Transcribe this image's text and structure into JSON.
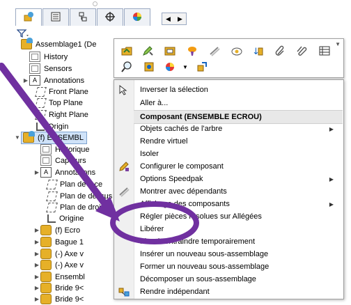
{
  "tree": {
    "tab_icons": [
      "featuremanager-icon",
      "propertymanager-icon",
      "configuration-icon",
      "dimxpert-icon",
      "appearance-icon"
    ],
    "filter_icon": "filter-icon",
    "items": [
      {
        "label": "Assemblage1 (De",
        "icon": "assembly-icon",
        "expander": ""
      },
      {
        "label": "History",
        "icon": "history-icon",
        "expander": ""
      },
      {
        "label": "Sensors",
        "icon": "sensors-icon",
        "expander": ""
      },
      {
        "label": "Annotations",
        "icon": "annotations-icon",
        "expander": "▶"
      },
      {
        "label": "Front Plane",
        "icon": "plane-icon",
        "expander": ""
      },
      {
        "label": "Top Plane",
        "icon": "plane-icon",
        "expander": ""
      },
      {
        "label": "Right Plane",
        "icon": "plane-icon",
        "expander": ""
      },
      {
        "label": "Origin",
        "icon": "origin-icon",
        "expander": ""
      },
      {
        "label": "(f) ENSEMBL",
        "icon": "assembly-icon",
        "expander": "▼"
      },
      {
        "label": "Historique",
        "icon": "history-icon",
        "expander": ""
      },
      {
        "label": "Capteurs",
        "icon": "sensors-icon",
        "expander": ""
      },
      {
        "label": "Annotations",
        "icon": "annotations-icon",
        "expander": "▶"
      },
      {
        "label": "Plan de face",
        "icon": "plane-icon",
        "expander": ""
      },
      {
        "label": "Plan de dessus",
        "icon": "plane-icon",
        "expander": ""
      },
      {
        "label": "Plan de droite",
        "icon": "plane-icon",
        "expander": ""
      },
      {
        "label": "Origine",
        "icon": "origin-icon",
        "expander": ""
      },
      {
        "label": "(f) Ecro",
        "icon": "part-icon",
        "expander": "▶"
      },
      {
        "label": "Bague 1",
        "icon": "part-icon",
        "expander": "▶"
      },
      {
        "label": "(-) Axe v",
        "icon": "part-icon",
        "expander": "▶"
      },
      {
        "label": "(-) Axe v",
        "icon": "part-icon",
        "expander": "▶"
      },
      {
        "label": "Ensembl",
        "icon": "part-icon",
        "expander": "▶"
      },
      {
        "label": "Bride 9<",
        "icon": "part-icon",
        "expander": "▶"
      },
      {
        "label": "Bride 9<",
        "icon": "part-icon",
        "expander": "▶"
      }
    ]
  },
  "toolbar": {
    "row1": [
      "open-part-icon",
      "edit-component-icon",
      "component-properties-icon",
      "appearance-brush-icon",
      "hide-icon",
      "isolate-icon",
      "mate-icon",
      "paperclip-icon",
      "link-icon",
      "table-icon"
    ],
    "row2": [
      "zoom-to-selection-icon",
      "component-view-icon",
      "appearance-ball-icon",
      "dropdown-arrow-icon",
      "configure-icon"
    ]
  },
  "menu": {
    "items": [
      {
        "label": "Inverser la sélection",
        "type": "item",
        "icon": "invert-selection-icon",
        "submenu": false
      },
      {
        "label": "Aller à...",
        "type": "item",
        "icon": "",
        "submenu": false
      },
      {
        "label": "Composant (ENSEMBLE ECROU)",
        "type": "header"
      },
      {
        "label": "Objets cachés de l'arbre",
        "type": "item",
        "icon": "",
        "submenu": true
      },
      {
        "label": "Rendre virtuel",
        "type": "item",
        "icon": "",
        "submenu": false
      },
      {
        "label": "Isoler",
        "type": "item",
        "icon": "",
        "submenu": false
      },
      {
        "label": "Configurer le composant",
        "type": "item",
        "icon": "configure-component-icon",
        "submenu": false
      },
      {
        "label": "Options Speedpak",
        "type": "item",
        "icon": "",
        "submenu": true
      },
      {
        "label": "Montrer avec dépendants",
        "type": "item",
        "icon": "show-dependents-icon",
        "submenu": false
      },
      {
        "label": "Affichage des composants",
        "type": "item",
        "icon": "",
        "submenu": true
      },
      {
        "label": "Régler pièces résolues sur Allégées",
        "type": "item",
        "icon": "",
        "submenu": false
      },
      {
        "label": "Libérer",
        "type": "item",
        "icon": "",
        "submenu": false
      },
      {
        "label": "Fixer/Contraindre temporairement",
        "type": "item",
        "icon": "",
        "submenu": false
      },
      {
        "label": "Insérer un nouveau sous-assemblage",
        "type": "item",
        "icon": "",
        "submenu": false
      },
      {
        "label": "Former un nouveau sous-assemblage",
        "type": "item",
        "icon": "",
        "submenu": false
      },
      {
        "label": "Décomposer un sous-assemblage",
        "type": "item",
        "icon": "",
        "submenu": false
      },
      {
        "label": "Rendre indépendant",
        "type": "item",
        "icon": "make-independent-icon",
        "submenu": false
      }
    ]
  },
  "colors": {
    "annotation_purple": "#7030a0",
    "selection_blue": "#cfe2f8",
    "tab_border": "#9aa9c2"
  }
}
